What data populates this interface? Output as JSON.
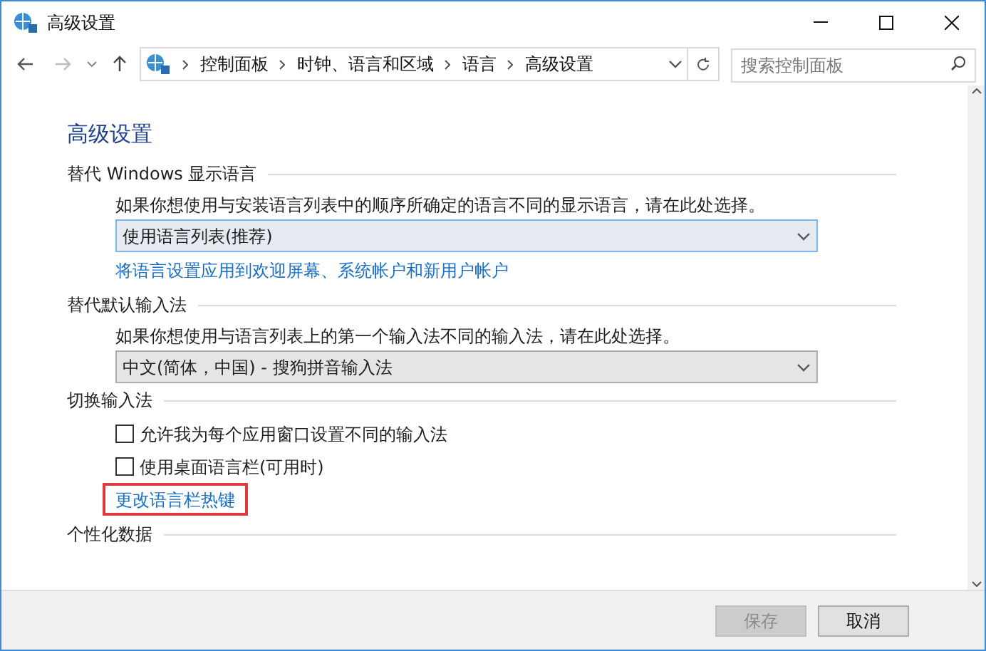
{
  "window": {
    "title": "高级设置"
  },
  "nav": {
    "breadcrumbs": [
      "控制面板",
      "时钟、语言和区域",
      "语言",
      "高级设置"
    ],
    "search": {
      "placeholder": "搜索控制面板"
    }
  },
  "page": {
    "heading": "高级设置"
  },
  "sections": [
    {
      "title": "替代 Windows 显示语言",
      "description": "如果你想使用与安装语言列表中的顺序所确定的语言不同的显示语言，请在此处选择。",
      "dropdown": {
        "value": "使用语言列表(推荐)",
        "focused": true
      },
      "link": {
        "label": "将语言设置应用到欢迎屏幕、系统帐户和新用户帐户",
        "highlighted": false
      }
    },
    {
      "title": "替代默认输入法",
      "description": "如果你想使用与语言列表上的第一个输入法不同的输入法，请在此处选择。",
      "dropdown": {
        "value": "中文(简体，中国) - 搜狗拼音输入法",
        "focused": false
      }
    },
    {
      "title": "切换输入法",
      "checkboxes": [
        {
          "label": "允许我为每个应用窗口设置不同的输入法",
          "checked": false
        },
        {
          "label": "使用桌面语言栏(可用时)",
          "checked": false
        }
      ],
      "link": {
        "label": "更改语言栏热键",
        "highlighted": true
      }
    },
    {
      "title": "个性化数据"
    }
  ],
  "footer": {
    "buttons": [
      {
        "label": "保存",
        "disabled": true
      },
      {
        "label": "取消",
        "disabled": false
      }
    ]
  }
}
